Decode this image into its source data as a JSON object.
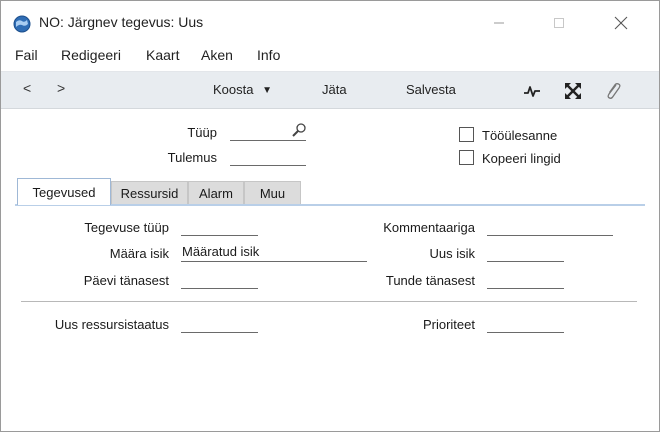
{
  "window": {
    "title": "NO: Järgnev tegevus: Uus",
    "minimize_glyph": "—",
    "maximize_glyph": "☐",
    "close_glyph": "✕"
  },
  "menu": [
    {
      "label": "Fail"
    },
    {
      "label": "Redigeeri"
    },
    {
      "label": "Kaart"
    },
    {
      "label": "Aken"
    },
    {
      "label": "Info"
    }
  ],
  "toolbar": {
    "prev": "<",
    "next": ">",
    "koosta": "Koosta",
    "koosta_arrow": "▼",
    "jata": "Jäta",
    "salvesta": "Salvesta",
    "icons": [
      "activity-icon",
      "expand-icon",
      "paperclip-icon"
    ]
  },
  "header": {
    "tyyp_label": "Tüüp",
    "tyyp_value": "",
    "tulemus_label": "Tulemus",
    "tulemus_value": "",
    "toolesanne_label": "Tööülesanne",
    "kopeeri_label": "Kopeeri lingid",
    "toolesanne_checked": false,
    "kopeeri_checked": false
  },
  "tabs": [
    {
      "label": "Tegevused",
      "active": true
    },
    {
      "label": "Ressursid",
      "active": false
    },
    {
      "label": "Alarm",
      "active": false
    },
    {
      "label": "Muu",
      "active": false
    }
  ],
  "fields": {
    "tegevuse_tyyp_label": "Tegevuse tüüp",
    "tegevuse_tyyp_value": "",
    "maara_isik_label": "Määra isik",
    "maara_isik_value": "Määratud isik",
    "paevi_label": "Päevi tänasest",
    "paevi_value": "",
    "kommentaariga_label": "Kommentaariga",
    "kommentaariga_value": "",
    "uus_isik_label": "Uus isik",
    "uus_isik_value": "",
    "tunde_label": "Tunde tänasest",
    "tunde_value": "",
    "uus_ressursistaatus_label": "Uus ressursistaatus",
    "uus_ressursistaatus_value": "",
    "prioriteet_label": "Prioriteet",
    "prioriteet_value": ""
  },
  "colors": {
    "toolbar_bg": "#e8ecf0",
    "tab_accent": "#b9cfe8",
    "app_icon_blue": "#2f6db5"
  }
}
